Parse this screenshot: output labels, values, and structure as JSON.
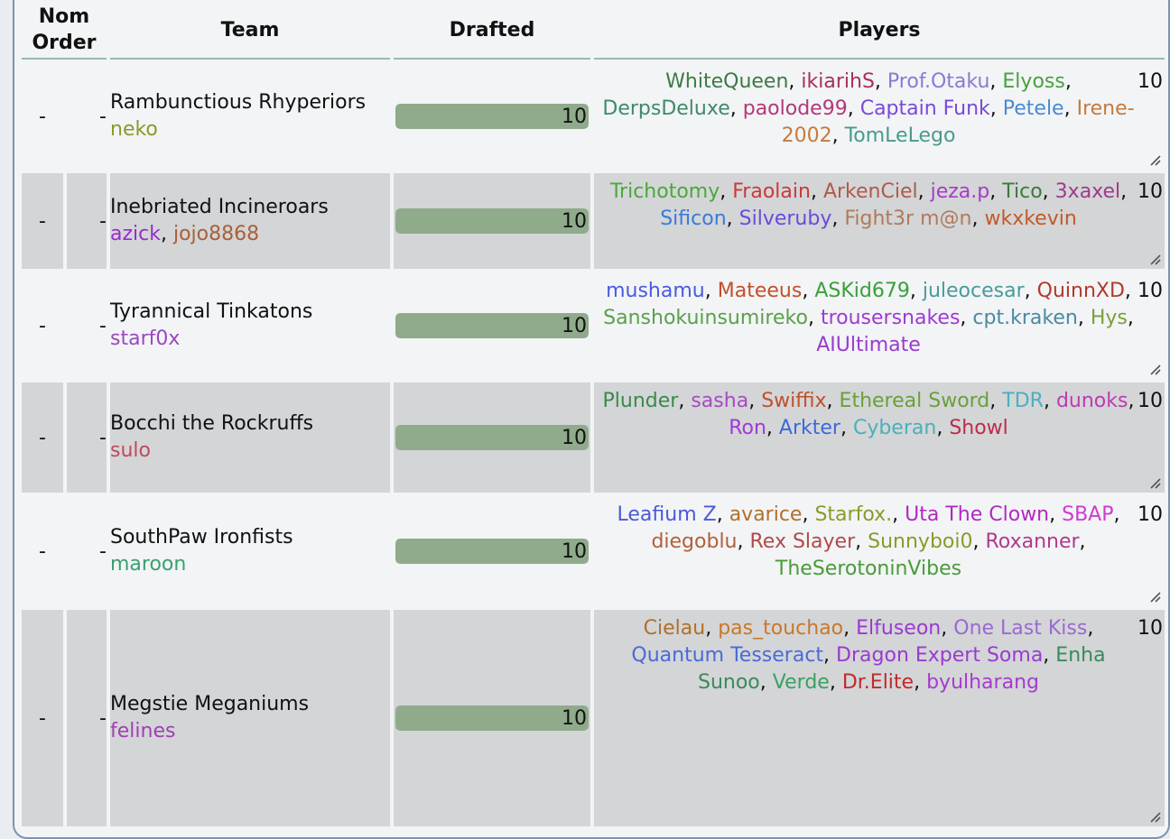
{
  "columns": {
    "nom_order": "Nom\nOrder",
    "nom_line1": "Nom",
    "nom_line2": "Order",
    "team": "Team",
    "drafted": "Drafted",
    "players": "Players"
  },
  "drafted_max": 10,
  "bar_color": "#8fab8b",
  "teams": [
    {
      "nom": "-",
      "order": "-",
      "name": "Rambunctious Rhyperiors",
      "owners": [
        {
          "name": "neko",
          "color": "#8a9a2a"
        }
      ],
      "drafted": 10,
      "count": "10",
      "players": [
        {
          "name": "WhiteQueen",
          "color": "#3d7a45"
        },
        {
          "name": "ikiarihS",
          "color": "#a8305a"
        },
        {
          "name": "Prof.Otaku",
          "color": "#8a7ad0"
        },
        {
          "name": "Elyoss",
          "color": "#4aa040"
        },
        {
          "name": "DerpsDeluxe",
          "color": "#3f8a6a"
        },
        {
          "name": "paolode99",
          "color": "#b23878"
        },
        {
          "name": "Captain Funk",
          "color": "#7a48d8"
        },
        {
          "name": "Petele",
          "color": "#4a8ad0"
        },
        {
          "name": "Irene-2002",
          "color": "#c77a3a"
        },
        {
          "name": "TomLeLego",
          "color": "#4a9a8a"
        }
      ]
    },
    {
      "nom": "-",
      "order": "-",
      "name": "Inebriated Incineroars",
      "owners": [
        {
          "name": "azick",
          "color": "#9a2ad0"
        },
        {
          "name": "jojo8868",
          "color": "#a8603a"
        }
      ],
      "drafted": 10,
      "count": "10",
      "players": [
        {
          "name": "Trichotomy",
          "color": "#4aa83a"
        },
        {
          "name": "Fraolain",
          "color": "#c83a3a"
        },
        {
          "name": "ArkenCiel",
          "color": "#b05a4a"
        },
        {
          "name": "jeza.p",
          "color": "#a83ac8"
        },
        {
          "name": "Tico",
          "color": "#3a7a3a"
        },
        {
          "name": "3xaxel",
          "color": "#a03a8a"
        },
        {
          "name": "Sificon",
          "color": "#3a7ad8"
        },
        {
          "name": "Silveruby",
          "color": "#6a4ad8"
        },
        {
          "name": "Fight3r m@n",
          "color": "#b07a5a"
        },
        {
          "name": "wkxkevin",
          "color": "#c05a2a"
        }
      ]
    },
    {
      "nom": "-",
      "order": "-",
      "name": "Tyrannical Tinkatons",
      "owners": [
        {
          "name": "starf0x",
          "color": "#9a48c0"
        }
      ],
      "drafted": 10,
      "count": "10",
      "players": [
        {
          "name": "mushamu",
          "color": "#4a5ae0"
        },
        {
          "name": "Mateeus",
          "color": "#c0502a"
        },
        {
          "name": "ASKid679",
          "color": "#3aa03a"
        },
        {
          "name": "juleocesar",
          "color": "#4a9a9a"
        },
        {
          "name": "QuinnXD",
          "color": "#b03a2a"
        },
        {
          "name": "Sanshokuinsumireko",
          "color": "#5aa04a"
        },
        {
          "name": "trousersnakes",
          "color": "#a03ad0"
        },
        {
          "name": "cpt.kraken",
          "color": "#4a8aa0"
        },
        {
          "name": "Hys",
          "color": "#7aa03a"
        },
        {
          "name": "AIUltimate",
          "color": "#9a3ad0"
        }
      ]
    },
    {
      "nom": "-",
      "order": "-",
      "name": "Bocchi the Rockruffs",
      "owners": [
        {
          "name": "sulo",
          "color": "#c04a5a"
        }
      ],
      "drafted": 10,
      "count": "10",
      "players": [
        {
          "name": "Plunder",
          "color": "#3a8a4a"
        },
        {
          "name": "sasha",
          "color": "#a84ac0"
        },
        {
          "name": "Swiffix",
          "color": "#c0502a"
        },
        {
          "name": "Ethereal Sword",
          "color": "#6aa03a"
        },
        {
          "name": "TDR",
          "color": "#4ab0c0"
        },
        {
          "name": "dunoks",
          "color": "#c03ab0"
        },
        {
          "name": "Ron",
          "color": "#a03ad8"
        },
        {
          "name": "Arkter",
          "color": "#3a6ad8"
        },
        {
          "name": "Cyberan",
          "color": "#4ab0b8"
        },
        {
          "name": "Showl",
          "color": "#c02a4a"
        }
      ]
    },
    {
      "nom": "-",
      "order": "-",
      "name": "SouthPaw Ironfists",
      "owners": [
        {
          "name": "maroon",
          "color": "#3aa070"
        }
      ],
      "drafted": 10,
      "count": "10",
      "players": [
        {
          "name": "Leafium Z",
          "color": "#4a5ad8"
        },
        {
          "name": "avarice",
          "color": "#b0702a"
        },
        {
          "name": "Starfox.",
          "color": "#8a9a2a"
        },
        {
          "name": "Uta The Clown",
          "color": "#b02ac0"
        },
        {
          "name": "SBAP",
          "color": "#d03ad0"
        },
        {
          "name": "diegoblu",
          "color": "#b0603a"
        },
        {
          "name": "Rex Slayer",
          "color": "#b04a4a"
        },
        {
          "name": "Sunnyboi0",
          "color": "#8a9a2a"
        },
        {
          "name": "Roxanner",
          "color": "#b03a8a"
        },
        {
          "name": "TheSerotoninVibes",
          "color": "#4a9a3a"
        }
      ]
    },
    {
      "nom": "-",
      "order": "-",
      "name": "Megstie Meganiums",
      "owners": [
        {
          "name": "felines",
          "color": "#a040b0"
        }
      ],
      "drafted": 10,
      "count": "10",
      "players": [
        {
          "name": "Cielau",
          "color": "#b0702a"
        },
        {
          "name": "pas_touchao",
          "color": "#c8782a"
        },
        {
          "name": "Elfuseon",
          "color": "#9a3ad0"
        },
        {
          "name": "One Last Kiss",
          "color": "#9a6ad0"
        },
        {
          "name": "Quantum Tesseract",
          "color": "#4a6ad8"
        },
        {
          "name": "Dragon Expert Soma",
          "color": "#9a3ad0"
        },
        {
          "name": "Enha Sunoo",
          "color": "#3a8a5a"
        },
        {
          "name": "Verde",
          "color": "#3aa060"
        },
        {
          "name": "Dr.Elite",
          "color": "#c02a2a"
        },
        {
          "name": "byulharang",
          "color": "#a83ad0"
        }
      ]
    }
  ]
}
